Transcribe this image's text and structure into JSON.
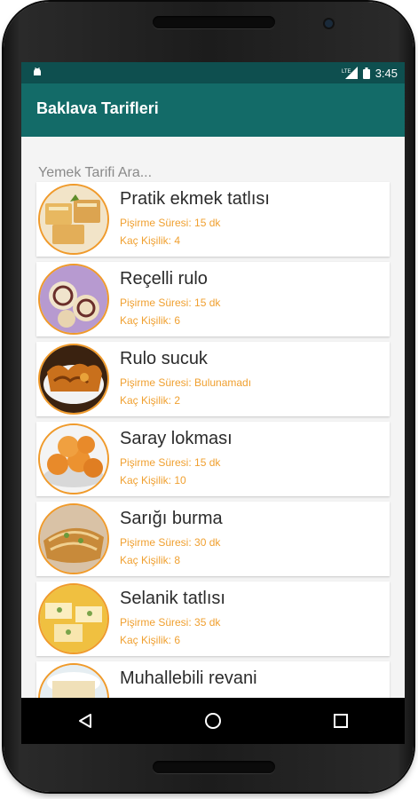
{
  "status_bar": {
    "time": "3:45",
    "network": "LTE"
  },
  "app_bar": {
    "title": "Baklava Tarifleri"
  },
  "search": {
    "placeholder": "Yemek Tarifi Ara..."
  },
  "colors": {
    "app_bar": "#136b68",
    "status_bar": "#0e4f4f",
    "accent": "#f0a030",
    "thumb_border": "#f09a2a"
  },
  "recipes": [
    {
      "title": "Pratik ekmek tatlısı",
      "time": "Pişirme Süresi: 15 dk",
      "servings": "Kaç Kişilik: 4"
    },
    {
      "title": "Reçelli rulo",
      "time": "Pişirme Süresi: 15 dk",
      "servings": "Kaç Kişilik: 6"
    },
    {
      "title": "Rulo sucuk",
      "time": "Pişirme Süresi: Bulunamadı",
      "servings": "Kaç Kişilik: 2"
    },
    {
      "title": "Saray lokması",
      "time": "Pişirme Süresi: 15 dk",
      "servings": "Kaç Kişilik: 10"
    },
    {
      "title": "Sarığı burma",
      "time": "Pişirme Süresi: 30 dk",
      "servings": "Kaç Kişilik: 8"
    },
    {
      "title": "Selanik tatlısı",
      "time": "Pişirme Süresi: 35 dk",
      "servings": "Kaç Kişilik: 6"
    },
    {
      "title": "Muhallebili revani",
      "time": "",
      "servings": ""
    }
  ],
  "nav": {
    "back_icon": "back-triangle-icon",
    "home_icon": "home-circle-icon",
    "recents_icon": "recents-square-icon"
  }
}
